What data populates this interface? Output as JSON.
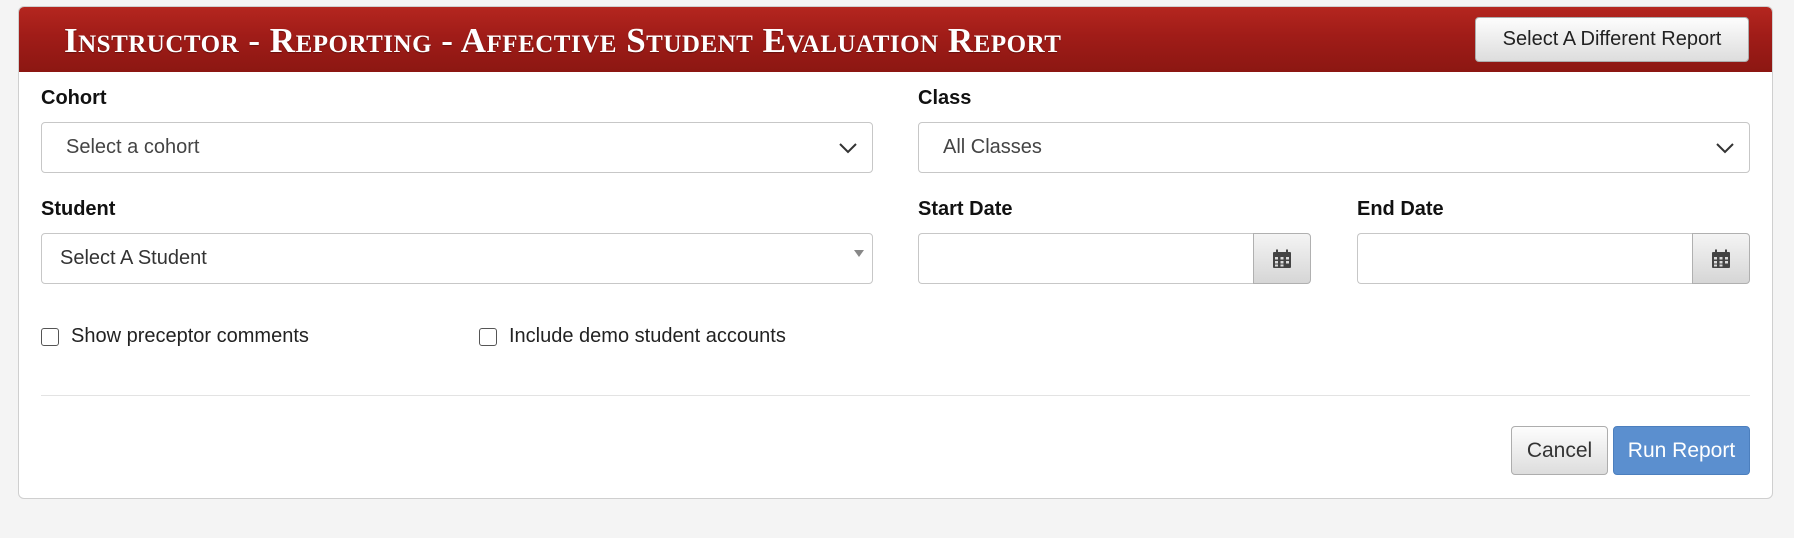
{
  "header": {
    "title": "Instructor - Reporting - Affective Student Evaluation Report",
    "select_report_label": "Select A Different Report",
    "brand_color": "#a01c18"
  },
  "form": {
    "cohort": {
      "label": "Cohort",
      "value": "Select a cohort"
    },
    "class": {
      "label": "Class",
      "value": "All Classes"
    },
    "student": {
      "label": "Student",
      "value": "Select A Student"
    },
    "start_date": {
      "label": "Start Date",
      "value": "",
      "icon": "calendar-icon"
    },
    "end_date": {
      "label": "End Date",
      "value": "",
      "icon": "calendar-icon"
    },
    "show_preceptor_comments": {
      "label": "Show preceptor comments",
      "checked": false
    },
    "include_demo_accounts": {
      "label": "Include demo student accounts",
      "checked": false
    }
  },
  "actions": {
    "cancel_label": "Cancel",
    "run_label": "Run Report",
    "run_color": "#5b8fcf"
  }
}
